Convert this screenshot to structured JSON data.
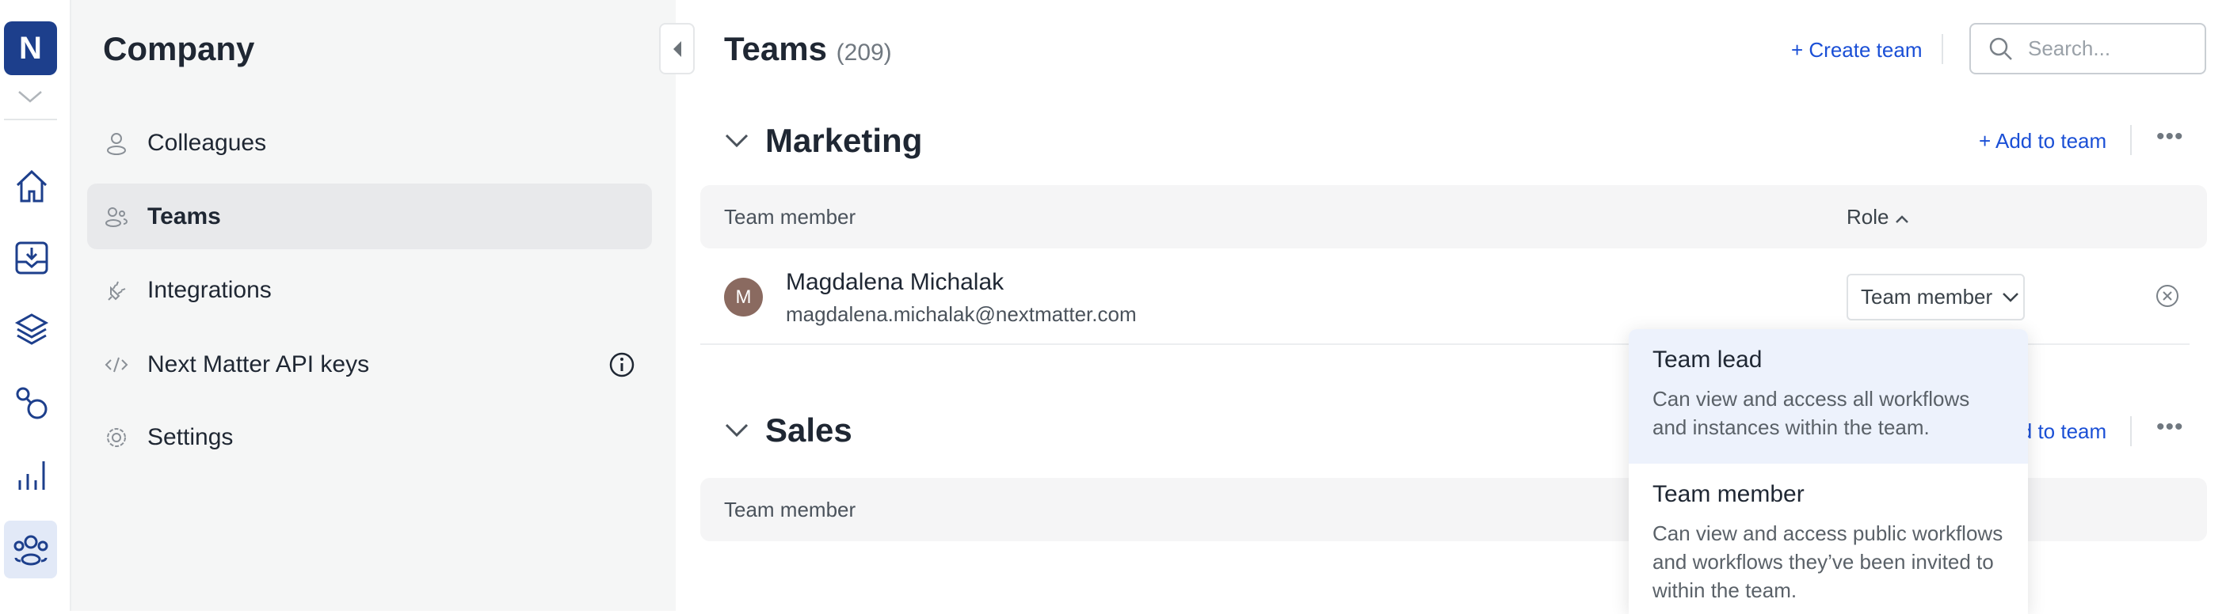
{
  "rail": {
    "logo": "N",
    "icons": [
      "home-icon",
      "inbox-icon",
      "layers-icon",
      "flow-icon",
      "analytics-icon",
      "teams-icon"
    ],
    "active": "teams-icon",
    "accent": "#1d3f8c"
  },
  "sidebar": {
    "title": "Company",
    "items": [
      {
        "label": "Colleagues",
        "icon": "user-icon"
      },
      {
        "label": "Teams",
        "icon": "users-icon",
        "active": true
      },
      {
        "label": "Integrations",
        "icon": "plug-icon"
      },
      {
        "label": "Next Matter API keys",
        "icon": "code-icon",
        "info": true
      },
      {
        "label": "Settings",
        "icon": "gear-icon"
      }
    ]
  },
  "header": {
    "title": "Teams",
    "count": "(209)",
    "create_label": "+ Create team",
    "search_placeholder": "Search..."
  },
  "teams": [
    {
      "name": "Marketing",
      "add_label": "+ Add to team",
      "col_member": "Team member",
      "col_role": "Role",
      "members": [
        {
          "initial": "M",
          "name": "Magdalena Michalak",
          "email": "magdalena.michalak@nextmatter.com",
          "role": "Team member"
        }
      ]
    },
    {
      "name": "Sales",
      "add_label": "+ Add to team",
      "col_member": "Team member"
    }
  ],
  "role_dropdown": {
    "options": [
      {
        "title": "Team lead",
        "desc": "Can view and access all workflows and instances within the team.",
        "highlighted": true
      },
      {
        "title": "Team member",
        "desc": "Can view and access public workflows and workflows they’ve been invited to within the team."
      }
    ]
  },
  "colors": {
    "link": "#1a4fd6",
    "highlight": "#edf2fc"
  }
}
